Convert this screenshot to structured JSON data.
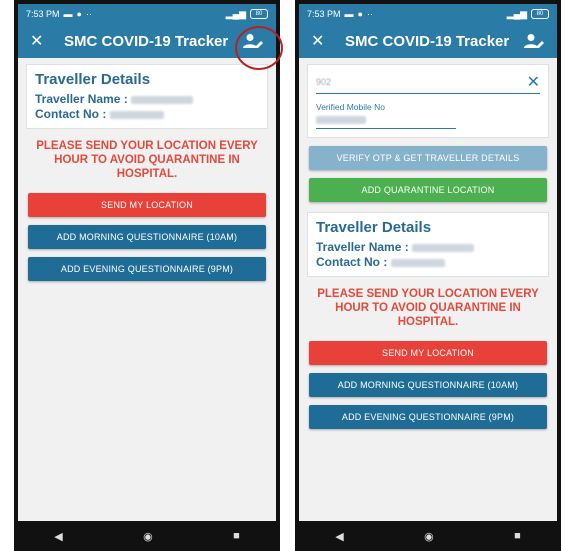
{
  "status": {
    "time": "7:53 PM",
    "battery": "80"
  },
  "appbar": {
    "title": "SMC COVID-19 Tracker"
  },
  "traveller": {
    "heading": "Traveller Details",
    "name_label": "Traveller Name :",
    "contact_label": "Contact No :"
  },
  "warning": "PLEASE SEND YOUR LOCATION EVERY HOUR TO AVOID QUARANTINE IN HOSPITAL.",
  "buttons": {
    "send_location": "SEND MY LOCATION",
    "morning": "ADD MORNING QUESTIONNAIRE (10AM)",
    "evening": "ADD EVENING QUESTIONNAIRE (9PM)",
    "verify_otp": "VERIFY OTP & GET TRAVELLER DETAILS",
    "add_quarantine": "ADD QUARANTINE LOCATION"
  },
  "form": {
    "otp_value": "902",
    "verified_mobile_label": "Verified Mobile No"
  },
  "colors": {
    "primary": "#2a7ba6",
    "danger": "#e8413a",
    "success": "#4caf50",
    "highlight": "#b52222"
  }
}
